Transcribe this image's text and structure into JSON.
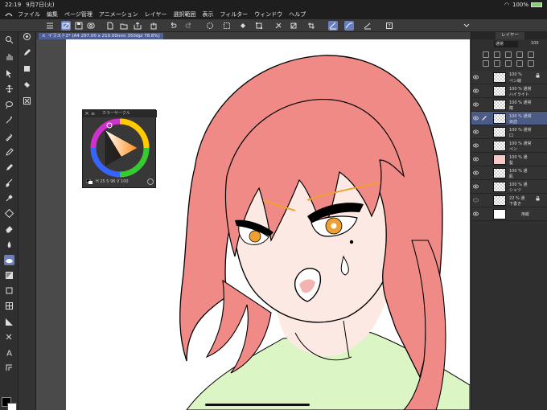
{
  "status": {
    "time": "22:19",
    "date": "9月7日(火)",
    "battery": "100%"
  },
  "menu": [
    "ファイル",
    "編集",
    "ページ管理",
    "アニメーション",
    "レイヤー",
    "選択範囲",
    "表示",
    "フィルター",
    "ウィンドウ",
    "ヘルプ"
  ],
  "document_tab": {
    "label": "イラスト2* (A4 297.00 x 210.00mm 350dpi 78.8%)"
  },
  "color_palette": {
    "title": "カラーサークル",
    "values": "H 25  S 96  V 100"
  },
  "layer_panel": {
    "tab_label": "レイヤー",
    "blend_mode": "通常",
    "opacity": "100",
    "layers": [
      {
        "mode": "100 %",
        "name": "ペン線",
        "selected": false
      },
      {
        "mode": "100 % 通常",
        "name": "ハイライト",
        "selected": false
      },
      {
        "mode": "100 % 通常",
        "name": "瞳",
        "selected": false
      },
      {
        "mode": "100 % 通常",
        "name": "目詰",
        "selected": true
      },
      {
        "mode": "100 % 通常",
        "name": "口",
        "selected": false
      },
      {
        "mode": "100 % 通常",
        "name": "ペン",
        "selected": false
      },
      {
        "mode": "100 % 通",
        "name": "髪",
        "selected": false
      },
      {
        "mode": "100 % 通",
        "name": "肌",
        "selected": false
      },
      {
        "mode": "100 % 通",
        "name": "シャツ",
        "selected": false
      },
      {
        "mode": "22 % 通",
        "name": "下書き",
        "selected": false
      },
      {
        "mode": "",
        "name": "用紙",
        "selected": false
      }
    ]
  },
  "colors": {
    "hair": "#f08a86",
    "skin": "#fde9e4",
    "shirt": "#dcf5c4",
    "eye": "#f0a030",
    "accent": "#6a7fbf",
    "main_color": "#000000",
    "sub_color": "#ffffff"
  },
  "icons": {
    "toolbar": [
      "menu-icon",
      "canvas-icon",
      "save-icon",
      "open-icon",
      "new-icon",
      "undo-icon",
      "redo-icon",
      "select-icon",
      "fill-icon",
      "transform-icon",
      "ruler-icon",
      "snap-icon",
      "help-icon"
    ],
    "tools": [
      "zoom-icon",
      "hand-icon",
      "move-icon",
      "lasso-icon",
      "wand-icon",
      "eyedropper-icon",
      "pen-icon",
      "pencil-icon",
      "brush-icon",
      "airbrush-icon",
      "decoration-icon",
      "eraser-icon",
      "blend-icon",
      "fill-icon",
      "gradient-icon",
      "figure-icon",
      "frame-icon",
      "ruler-icon",
      "text-icon",
      "balloon-icon",
      "correct-line-icon"
    ]
  }
}
